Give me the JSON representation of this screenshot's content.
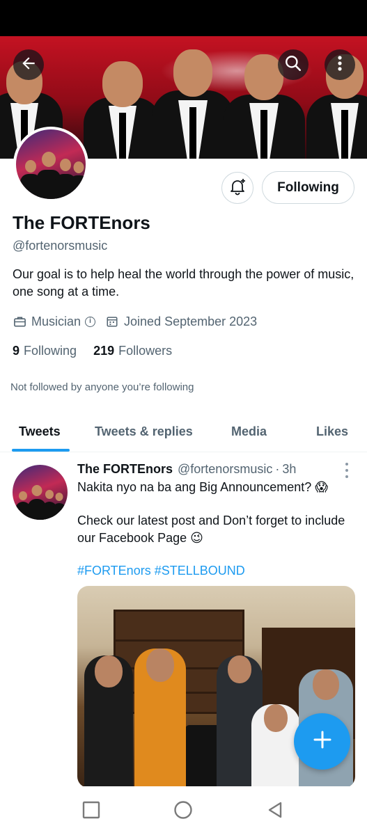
{
  "profile": {
    "display_name": "The FORTEnors",
    "handle": "@fortenorsmusic",
    "bio": "Our goal is to help heal the world through the power of music, one song at a time.",
    "category": "Musician",
    "joined": "Joined September 2023",
    "following_count": "9",
    "following_label": "Following",
    "followers_count": "219",
    "followers_label": "Followers",
    "not_followed_note": "Not followed by anyone you’re following"
  },
  "actions": {
    "following_button": "Following"
  },
  "tabs": [
    {
      "label": "Tweets",
      "active": true
    },
    {
      "label": "Tweets & replies",
      "active": false
    },
    {
      "label": "Media",
      "active": false
    },
    {
      "label": "Likes",
      "active": false
    }
  ],
  "tweet": {
    "author_name": "The FORTEnors",
    "author_handle": "@fortenorsmusic",
    "separator": "·",
    "time": "3h",
    "line1": "Nakita nyo na ba ang Big Announcement? 😱",
    "line2": "Check our latest post and Don’t forget to include our Facebook Page 😉",
    "hashtags": "#FORTEnors #STELLBOUND"
  },
  "icons": {
    "back": "arrow-left-icon",
    "search": "search-icon",
    "more": "more-vertical-icon",
    "notify": "bell-plus-icon",
    "category": "briefcase-icon",
    "info": "info-icon",
    "calendar": "calendar-icon",
    "compose": "plus-icon",
    "nav_recents": "square-icon",
    "nav_home": "circle-icon",
    "nav_back": "triangle-back-icon"
  },
  "colors": {
    "accent": "#1d9bf0",
    "text_primary": "#0f1419",
    "text_secondary": "#536471",
    "border": "#cfd9de"
  }
}
